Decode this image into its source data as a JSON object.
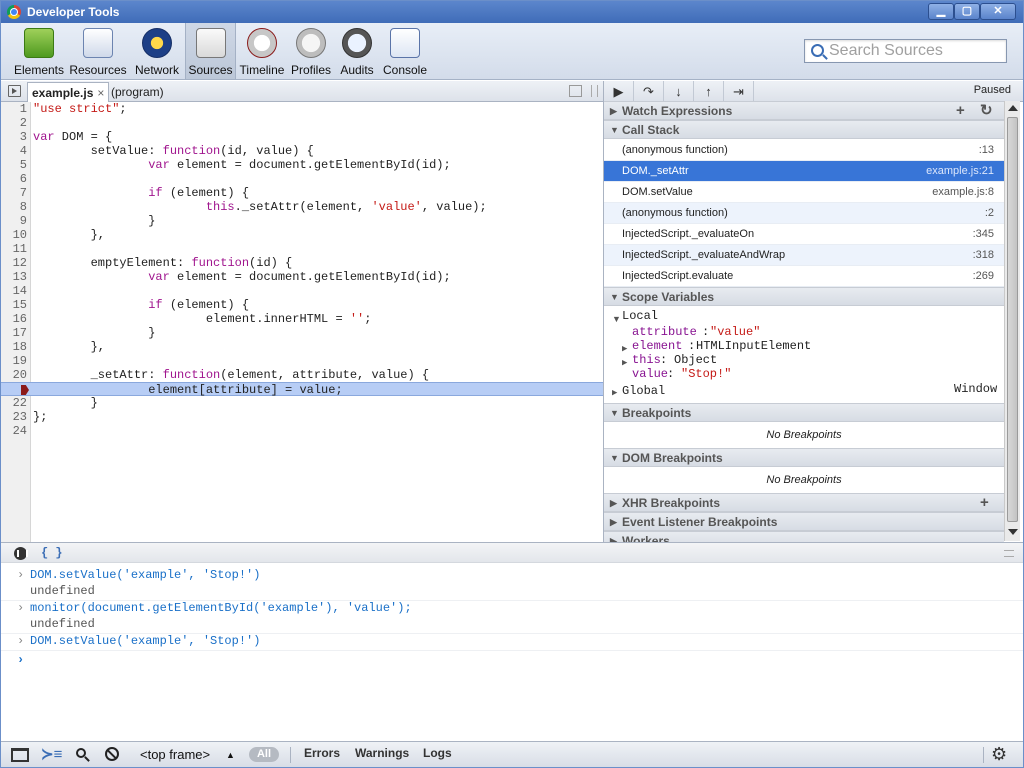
{
  "window": {
    "title": "Developer Tools"
  },
  "toolbar": {
    "items": [
      {
        "label": "Elements"
      },
      {
        "label": "Resources"
      },
      {
        "label": "Network"
      },
      {
        "label": "Sources"
      },
      {
        "label": "Timeline"
      },
      {
        "label": "Profiles"
      },
      {
        "label": "Audits"
      },
      {
        "label": "Console"
      }
    ],
    "active": "Sources",
    "search_placeholder": "Search Sources"
  },
  "editor": {
    "tabs": [
      {
        "label": "example.js",
        "close": "×"
      },
      {
        "label": "(program)"
      }
    ],
    "exec_line": 21,
    "lines": [
      {
        "n": "1",
        "t": "\"use strict\";"
      },
      {
        "n": "2",
        "t": ""
      },
      {
        "n": "3",
        "t": "var DOM = {"
      },
      {
        "n": "4",
        "t": "        setValue: function(id, value) {"
      },
      {
        "n": "5",
        "t": "                var element = document.getElementById(id);"
      },
      {
        "n": "6",
        "t": ""
      },
      {
        "n": "7",
        "t": "                if (element) {"
      },
      {
        "n": "8",
        "t": "                        this._setAttr(element, 'value', value);"
      },
      {
        "n": "9",
        "t": "                }"
      },
      {
        "n": "10",
        "t": "        },"
      },
      {
        "n": "11",
        "t": ""
      },
      {
        "n": "12",
        "t": "        emptyElement: function(id) {"
      },
      {
        "n": "13",
        "t": "                var element = document.getElementById(id);"
      },
      {
        "n": "14",
        "t": ""
      },
      {
        "n": "15",
        "t": "                if (element) {"
      },
      {
        "n": "16",
        "t": "                        element.innerHTML = '';"
      },
      {
        "n": "17",
        "t": "                }"
      },
      {
        "n": "18",
        "t": "        },"
      },
      {
        "n": "19",
        "t": ""
      },
      {
        "n": "20",
        "t": "        _setAttr: function(element, attribute, value) {"
      },
      {
        "n": "21",
        "t": "                element[attribute] = value;"
      },
      {
        "n": "22",
        "t": "        }"
      },
      {
        "n": "23",
        "t": "};"
      },
      {
        "n": "24",
        "t": ""
      }
    ]
  },
  "debugger": {
    "status": "Paused",
    "sections": {
      "watch": "Watch Expressions",
      "callstack": "Call Stack",
      "scope": "Scope Variables",
      "breakpoints": "Breakpoints",
      "dom_breakpoints": "DOM Breakpoints",
      "xhr_breakpoints": "XHR Breakpoints",
      "event_breakpoints": "Event Listener Breakpoints",
      "workers": "Workers"
    },
    "call_stack": [
      {
        "fn": "(anonymous function)",
        "loc": ":13"
      },
      {
        "fn": "DOM._setAttr",
        "loc": "example.js:21",
        "selected": true
      },
      {
        "fn": "DOM.setValue",
        "loc": "example.js:8"
      },
      {
        "fn": "(anonymous function)",
        "loc": ":2"
      },
      {
        "fn": "InjectedScript._evaluateOn",
        "loc": ":345"
      },
      {
        "fn": "InjectedScript._evaluateAndWrap",
        "loc": ":318"
      },
      {
        "fn": "InjectedScript.evaluate",
        "loc": ":269"
      }
    ],
    "scope": {
      "local_label": "Local",
      "vars": [
        {
          "name": "attribute",
          "value": "\"value\""
        },
        {
          "name": "element",
          "value": "HTMLInputElement"
        },
        {
          "name": "this",
          "value": "Object"
        },
        {
          "name": "value",
          "value": "\"Stop!\""
        }
      ],
      "global_label": "Global",
      "global_value": "Window"
    },
    "no_breakpoints": "No Breakpoints",
    "no_dom_breakpoints": "No Breakpoints"
  },
  "console": {
    "entries": [
      {
        "cmd": "DOM.setValue('example', 'Stop!')",
        "result": "undefined"
      },
      {
        "cmd": "monitor(document.getElementById('example'), 'value');",
        "result": "undefined"
      },
      {
        "cmd": "DOM.setValue('example', 'Stop!')"
      }
    ],
    "prompt": "›"
  },
  "statusbar": {
    "frame": "<top frame>",
    "filters": {
      "all": "All",
      "errors": "Errors",
      "warnings": "Warnings",
      "logs": "Logs"
    }
  },
  "colors": {
    "selection": "#3875d7",
    "exec_line": "#b7cdf5",
    "titlebar": "#4a77c0"
  }
}
